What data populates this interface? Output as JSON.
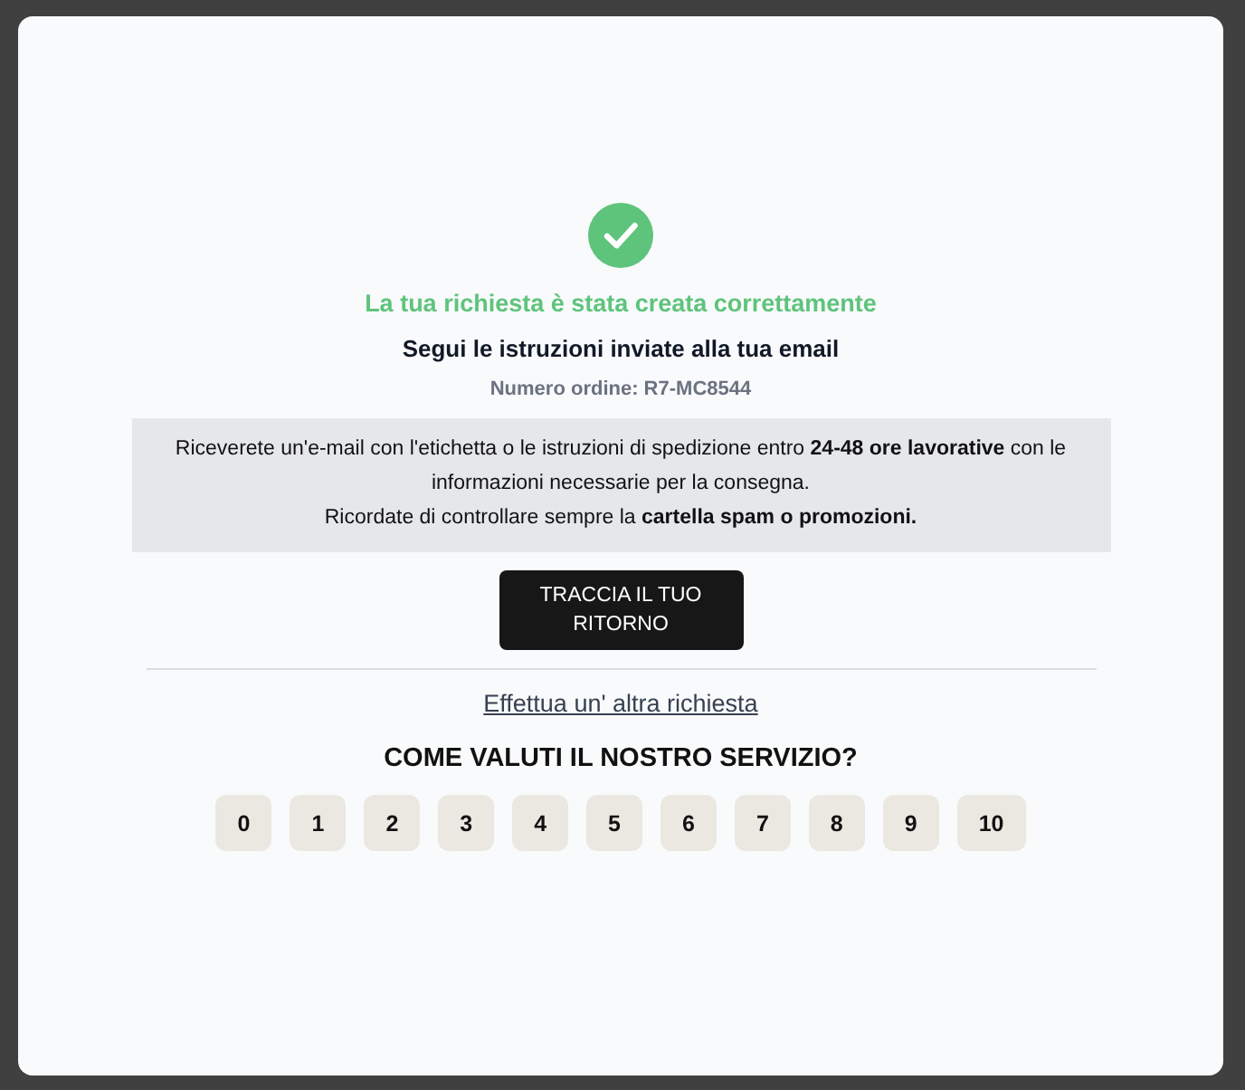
{
  "status": {
    "kind": "success",
    "title": "La tua richiesta è stata creata correttamente",
    "subtitle": "Segui le istruzioni inviate alla tua email",
    "order_number": "Numero ordine: R7-MC8544"
  },
  "info": {
    "paragraphs": [
      "Riceverete un'e-mail con l'etichetta o le istruzioni di spedizione entro **24-48 ore lavorative** con le informazioni necessarie per la consegna.",
      "Ricordate di controllare sempre la **cartella spam o promozioni.**"
    ]
  },
  "track_button": {
    "label": "TRACCIA IL TUO RITORNO"
  },
  "new_request_link": {
    "label": "Effettua un' altra richiesta"
  },
  "rating": {
    "question": "COME VALUTI IL NOSTRO SERVIZIO?",
    "options": [
      {
        "label": "0",
        "selected": false
      },
      {
        "label": "1",
        "selected": false
      },
      {
        "label": "2",
        "selected": false
      },
      {
        "label": "3",
        "selected": false
      },
      {
        "label": "4",
        "selected": false
      },
      {
        "label": "5",
        "selected": false
      },
      {
        "label": "6",
        "selected": false
      },
      {
        "label": "7",
        "selected": false
      },
      {
        "label": "8",
        "selected": false
      },
      {
        "label": "9",
        "selected": false
      },
      {
        "label": "10",
        "selected": false
      }
    ]
  }
}
